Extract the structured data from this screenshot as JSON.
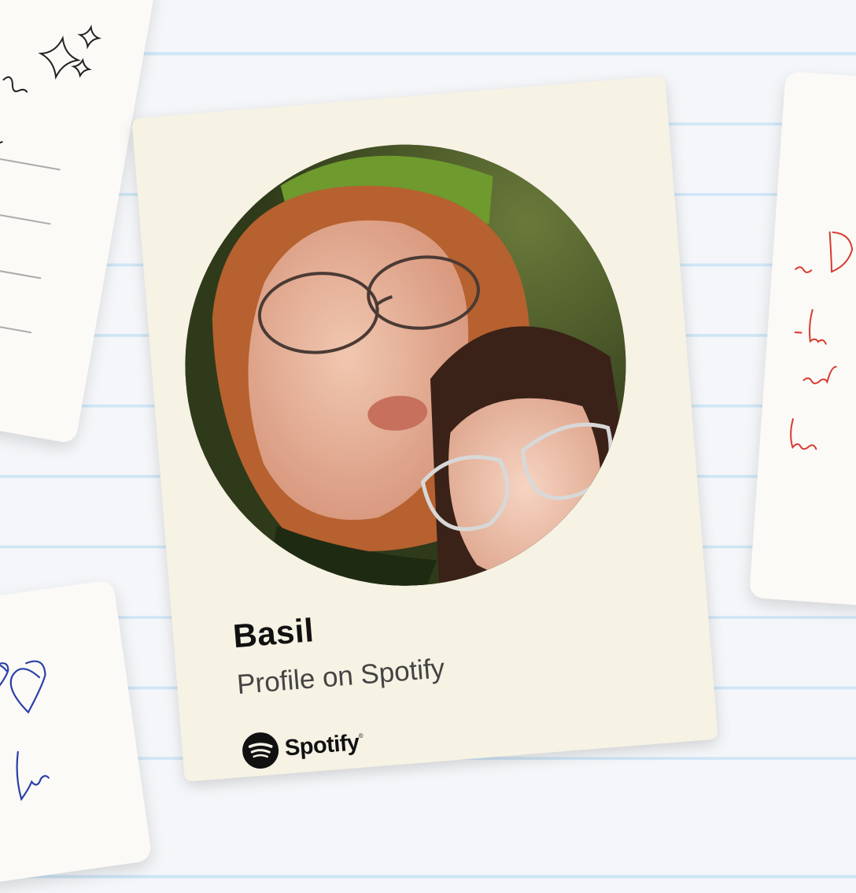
{
  "card": {
    "name": "Basil",
    "subtitle": "Profile on Spotify",
    "brand_label": "Spotify",
    "brand_trademark": "®",
    "avatar_description_icon": "profile-photo",
    "brand_icon": "spotify-logo-icon"
  },
  "colors": {
    "card_background": "#f6f2e4",
    "page_background": "#f4f6f9",
    "ruled_line": "#cfe6f6",
    "spotify_logo": "#111111",
    "doodle_black": "#222222",
    "doodle_red": "#d83a2f",
    "doodle_blue": "#2a3fa8"
  }
}
